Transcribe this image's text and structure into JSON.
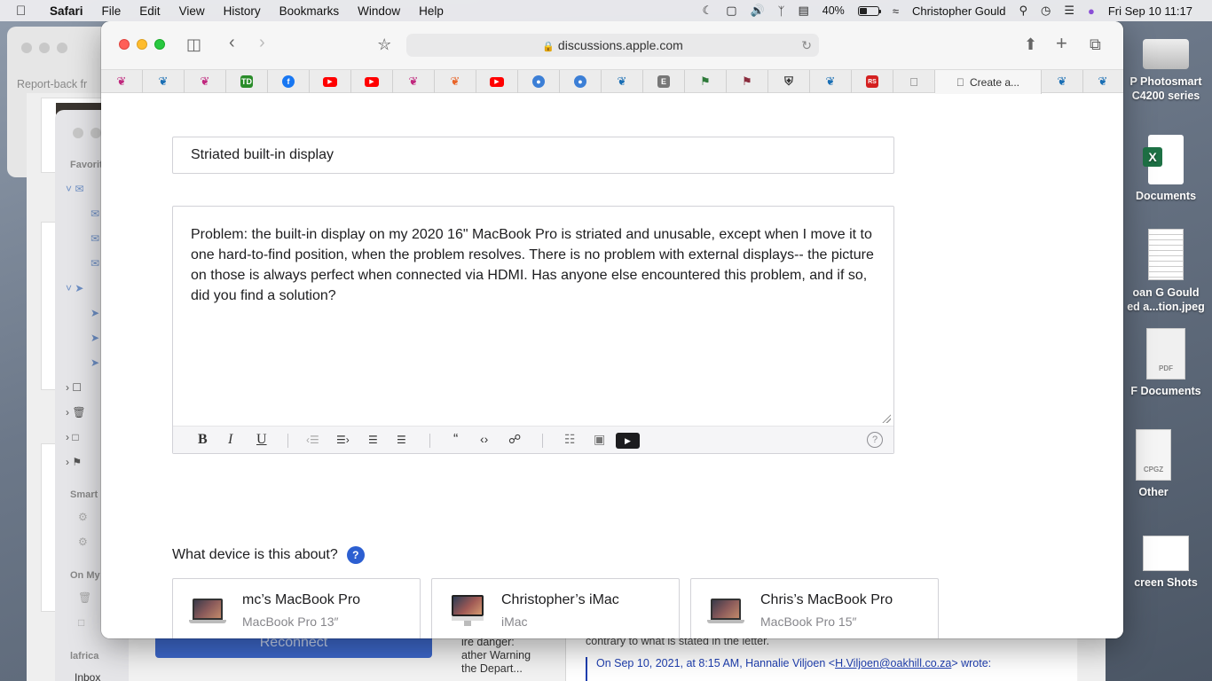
{
  "menubar": {
    "app": "Safari",
    "menus": [
      "File",
      "Edit",
      "View",
      "History",
      "Bookmarks",
      "Window",
      "Help"
    ],
    "battery_percent": "40%",
    "battery_level": 0.4,
    "user": "Christopher Gould",
    "datetime": "Fri Sep 10  11:17"
  },
  "background": {
    "report_window_title": "Report-back fr",
    "mail_sidebar": {
      "favorites_label": "Favorit",
      "smart_label": "Smart",
      "onmy_label": "On My",
      "lafrica_label": "lafrica",
      "inbox_label": "Inbox"
    },
    "reconnect_label": "Reconnect",
    "danger_lines": [
      "ire danger:",
      "ather Warning",
      "the Depart..."
    ],
    "mail_quote_line": "contrary to what is stated in the letter.",
    "mail_reply_prefix": "On Sep 10, 2021, at 8:15 AM, Hannalie Viljoen <",
    "mail_reply_email": "H.Viljoen@oakhill.co.za",
    "mail_reply_suffix": "> wrote:"
  },
  "desktop_icons": [
    {
      "label": "P Photosmart\nC4200 series"
    },
    {
      "label": "Documents"
    },
    {
      "label": "oan G Gould\ned a...tion.jpeg"
    },
    {
      "label": "F Documents"
    },
    {
      "label": "Other"
    },
    {
      "label": "creen Shots"
    }
  ],
  "safari": {
    "url": "discussions.apple.com",
    "active_tab": "Create a...",
    "favorites": [
      {
        "icon": "bird-pink-icon",
        "color": "#c0287e",
        "glyph": "❦"
      },
      {
        "icon": "bird-blue-icon",
        "color": "#1a6fb5",
        "glyph": "❦"
      },
      {
        "icon": "bird-pink-icon",
        "color": "#c0287e",
        "glyph": "❦"
      },
      {
        "icon": "td-bank-icon",
        "color": "#2a8c2a",
        "glyph": "TD"
      },
      {
        "icon": "facebook-icon",
        "color": "#1877f2",
        "glyph": "f"
      },
      {
        "icon": "youtube-icon",
        "color": "#ff0000",
        "glyph": "▶"
      },
      {
        "icon": "youtube-icon",
        "color": "#ff0000",
        "glyph": "▶"
      },
      {
        "icon": "bird-pink-icon",
        "color": "#c0287e",
        "glyph": "❦"
      },
      {
        "icon": "bird-orange-icon",
        "color": "#e8652a",
        "glyph": "❦"
      },
      {
        "icon": "youtube-icon",
        "color": "#ff0000",
        "glyph": "▶"
      },
      {
        "icon": "globe-blue-icon",
        "color": "#3c7fd6",
        "glyph": "●"
      },
      {
        "icon": "globe-blue-icon",
        "color": "#3c7fd6",
        "glyph": "●"
      },
      {
        "icon": "bird-blue-icon",
        "color": "#1a6fb5",
        "glyph": "❦"
      },
      {
        "icon": "e-letter-icon",
        "color": "#777777",
        "glyph": "E"
      },
      {
        "icon": "badge-green-icon",
        "color": "#2e7a3a",
        "glyph": "⚑"
      },
      {
        "icon": "flag-icon",
        "color": "#8a2c3d",
        "glyph": "⚑"
      },
      {
        "icon": "shield-icon",
        "color": "#333333",
        "glyph": "⛨"
      },
      {
        "icon": "bird-blue-icon",
        "color": "#1a6fb5",
        "glyph": "❦"
      },
      {
        "icon": "rs-icon",
        "color": "#d42020",
        "glyph": "RS"
      },
      {
        "icon": "apple-icon",
        "color": "#666666",
        "glyph": ""
      },
      {
        "icon": "bird-blue-icon",
        "color": "#1a6fb5",
        "glyph": "❦"
      },
      {
        "icon": "bird-blue-icon",
        "color": "#1a6fb5",
        "glyph": "❦"
      }
    ]
  },
  "form": {
    "title_value": "Striated built-in display",
    "body_text": "Problem: the built-in display on my 2020 16\" MacBook Pro is striated and unusable, except when I move it to one hard-to-find position, when the problem resolves. There is no problem with external displays-- the picture on those is always perfect when connected via HDMI. Has anyone else encountered this problem, and if so, did you find a solution?",
    "toolbar": {
      "bold": "B",
      "italic": "I",
      "underline": "U",
      "outdent": "‹☰",
      "indent": "☰›",
      "ordered_list": "☰",
      "bullet_list": "☰",
      "quote": "“",
      "code": "‹›",
      "link": "☍",
      "document": "☷",
      "image": "▣",
      "video": "▶",
      "help": "?"
    },
    "device_question": "What device is this about?",
    "device_help": "?",
    "devices": [
      {
        "name": "mc’s MacBook Pro",
        "model": "MacBook Pro 13″",
        "type": "laptop"
      },
      {
        "name": "Christopher’s iMac",
        "model": "iMac",
        "type": "imac"
      },
      {
        "name": "Chris’s MacBook Pro",
        "model": "MacBook Pro 15″",
        "type": "laptop"
      }
    ]
  }
}
